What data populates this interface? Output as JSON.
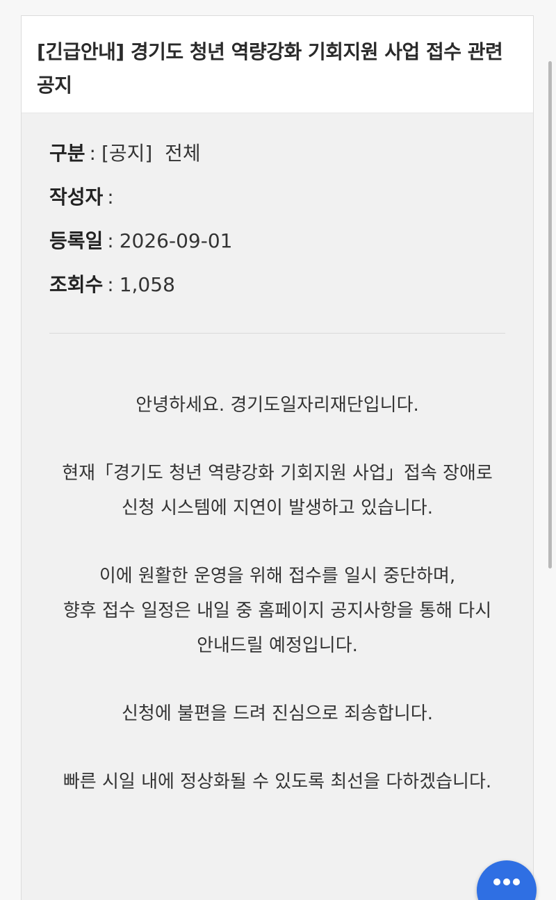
{
  "notice": {
    "title": "[긴급안내] 경기도 청년 역량강화 기회지원 사업 접수 관련 공지",
    "meta": [
      {
        "key": "구분",
        "value": "[공지]  전체"
      },
      {
        "key": "작성자",
        "value": ""
      },
      {
        "key": "등록일",
        "value": "2026-09-01"
      },
      {
        "key": "조회수",
        "value": "1,058"
      }
    ],
    "body": [
      "안녕하세요. 경기도일자리재단입니다.",
      "현재「경기도 청년 역량강화 기회지원 사업」접속 장애로",
      "신청 시스템에 지연이 발생하고 있습니다.",
      "이에 원활한 운영을 위해 접수를 일시 중단하며,",
      "향후 접수 일정은 내일 중 홈페이지 공지사항을 통해 다시",
      "안내드릴 예정입니다.",
      "신청에 불편을 드려 진심으로 죄송합니다.",
      "빠른 시일 내에 정상화될 수 있도록 최선을 다하겠습니다."
    ]
  },
  "fab": {
    "icon": "chat-bubble-icon",
    "color": "#2f6fe3"
  }
}
